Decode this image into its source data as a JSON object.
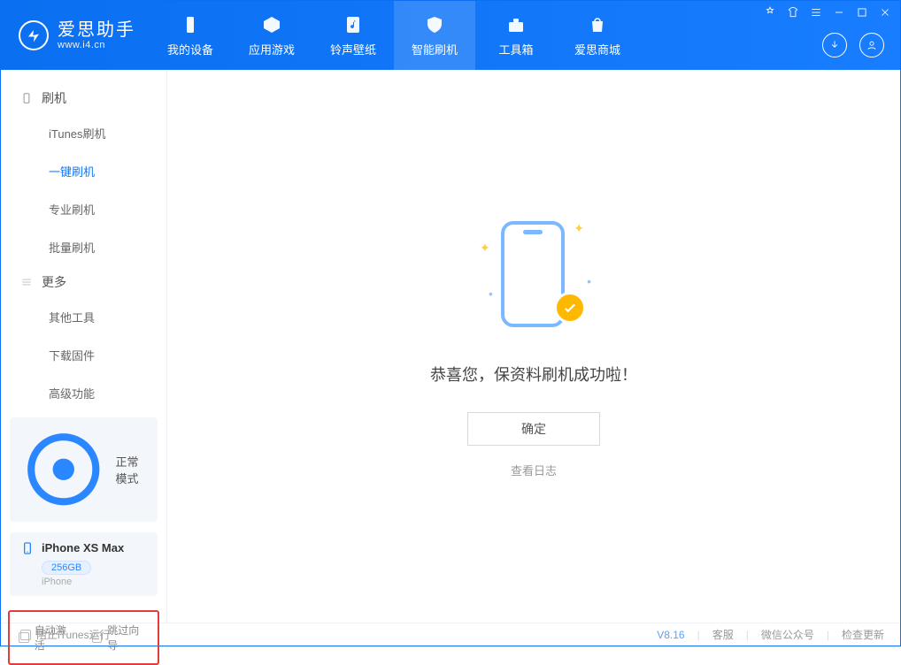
{
  "app": {
    "name_cn": "爱思助手",
    "name_en": "www.i4.cn"
  },
  "topTabs": [
    {
      "label": "我的设备",
      "icon": "device"
    },
    {
      "label": "应用游戏",
      "icon": "cube"
    },
    {
      "label": "铃声壁纸",
      "icon": "music"
    },
    {
      "label": "智能刷机",
      "icon": "shield",
      "active": true
    },
    {
      "label": "工具箱",
      "icon": "toolbox"
    },
    {
      "label": "爱思商城",
      "icon": "bag"
    }
  ],
  "sidebar": {
    "groups": [
      {
        "title": "刷机",
        "icon": "phone",
        "items": [
          "iTunes刷机",
          "一键刷机",
          "专业刷机",
          "批量刷机"
        ],
        "activeIndex": 1
      },
      {
        "title": "更多",
        "icon": "menu",
        "items": [
          "其他工具",
          "下载固件",
          "高级功能"
        ],
        "activeIndex": -1
      }
    ],
    "mode": {
      "label": "正常模式"
    },
    "device": {
      "name": "iPhone XS Max",
      "storage": "256GB",
      "type": "iPhone"
    },
    "options": [
      {
        "label": "自动激活",
        "checked": false
      },
      {
        "label": "跳过向导",
        "checked": false
      }
    ]
  },
  "main": {
    "success_msg": "恭喜您，保资料刷机成功啦！",
    "ok_label": "确定",
    "view_log_label": "查看日志"
  },
  "footer": {
    "block_itunes_label": "阻止iTunes运行",
    "version": "V8.16",
    "links": [
      "客服",
      "微信公众号",
      "检查更新"
    ]
  }
}
